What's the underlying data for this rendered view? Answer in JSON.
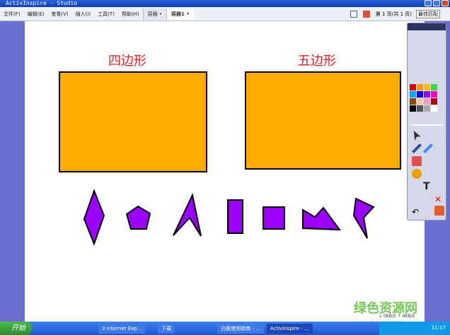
{
  "window": {
    "title": "ActivInspire - Studio"
  },
  "menu": [
    "文件(F)",
    "编辑(E)",
    "查看(V)",
    "插入(I)",
    "工具(T)",
    "帮助(H)"
  ],
  "tabs": [
    "容器 •",
    "容器1 •"
  ],
  "page_info": "第 1 页(共 1 页)",
  "zoom": "最佳匹配",
  "canvas": {
    "label_quad": "四边形",
    "label_pent": "五边形",
    "box_color": "#ffab00",
    "shape_color": "#9b00ff"
  },
  "palette": [
    "#e00000",
    "#ff9900",
    "#ffc000",
    "#33dd33",
    "#00aaff",
    "#0000ff",
    "#9900ff",
    "#ff00cc",
    "#8b4a00",
    "#f5c89a",
    "#f0a0c0",
    "#b00000",
    "#000000",
    "#555555",
    "#aaaaaa",
    "#ffffff"
  ],
  "taskbar": {
    "start": "开始",
    "tasks": [
      "3 Internet Exp...",
      "下载",
      "白板使用指南 - ...",
      "ActivInspire - ..."
    ],
    "clock": "11:17"
  },
  "network": {
    "down": "0KB/S",
    "up": "0KB/S"
  },
  "watermark": {
    "text": "绿色资源网",
    "url": "www.downcc.com"
  }
}
